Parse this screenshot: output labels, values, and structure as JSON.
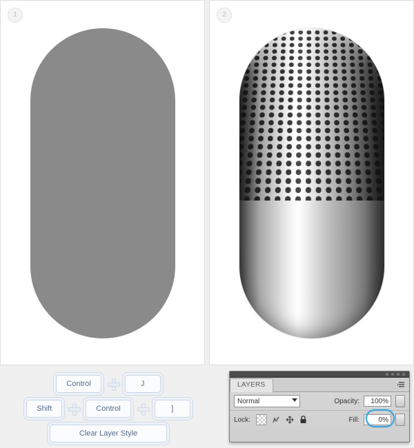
{
  "stages": {
    "one": "1",
    "two": "2"
  },
  "keys": {
    "ctrl": "Control",
    "shift": "Shift",
    "j": "J",
    "bracket": "]",
    "clear_style": "Clear Layer Style"
  },
  "panel": {
    "tab": "LAYERS",
    "blend_label": "Normal",
    "opacity_label": "Opacity:",
    "opacity_value": "100%",
    "lock_label": "Lock:",
    "fill_label": "Fill:",
    "fill_value": "0%"
  }
}
